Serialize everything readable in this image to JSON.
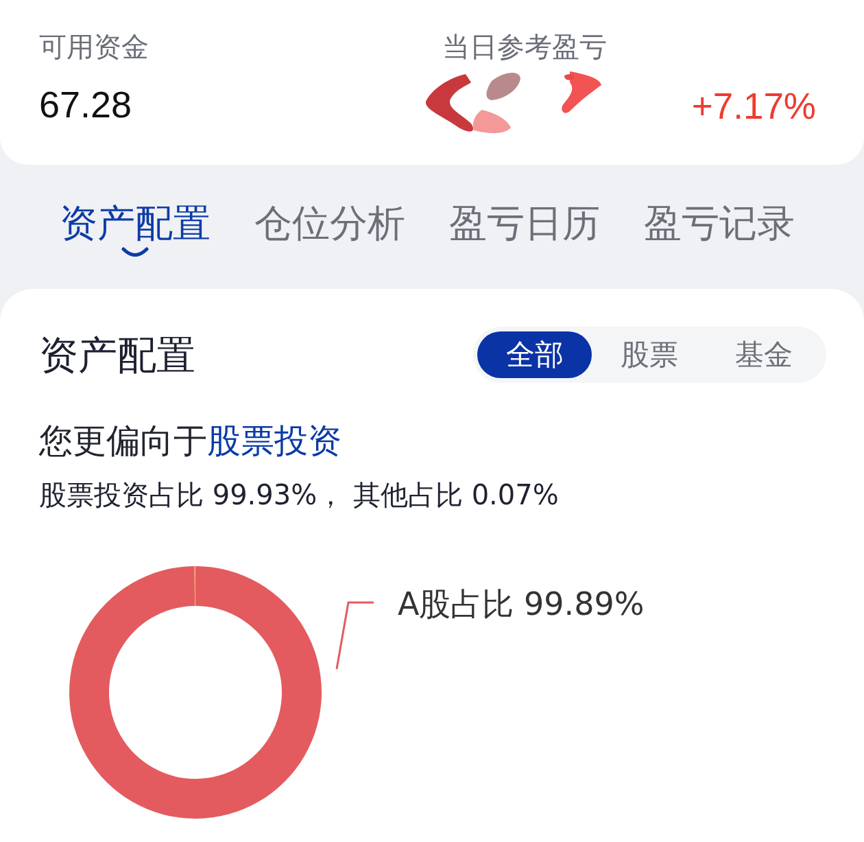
{
  "summary": {
    "available_funds": {
      "label": "可用资金",
      "value": "67.28"
    },
    "daily_pnl": {
      "label": "当日参考盈亏",
      "percent": "+7.17%",
      "positive": true
    }
  },
  "tabs": [
    {
      "label": "资产配置",
      "selected": true
    },
    {
      "label": "仓位分析",
      "selected": false
    },
    {
      "label": "盈亏日历",
      "selected": false
    },
    {
      "label": "盈亏记录",
      "selected": false
    }
  ],
  "section": {
    "title": "资产配置",
    "filters": [
      {
        "label": "全部",
        "selected": true
      },
      {
        "label": "股票",
        "selected": false
      },
      {
        "label": "基金",
        "selected": false
      }
    ],
    "preference": "您更偏向于**股票投资**",
    "ratio_text": "股票投资占比 99.93%， 其他占比 0.07%",
    "chart_data": {
      "type": "donut",
      "values": [
        99.89,
        0.11
      ],
      "value_labels": [
        "A股占比 99.89%",
        null
      ]
    }
  }
}
